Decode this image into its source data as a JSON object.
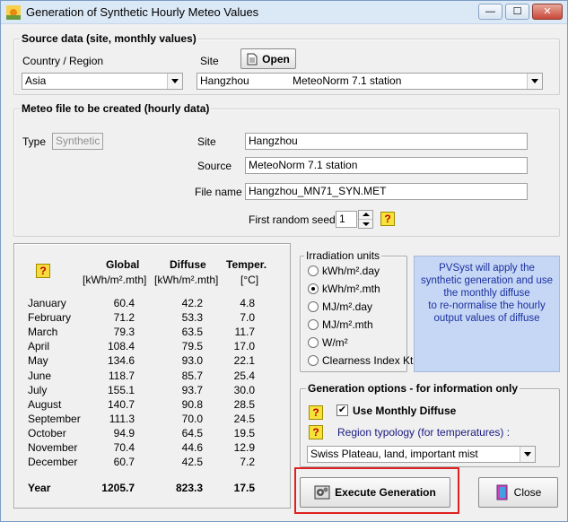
{
  "window": {
    "title": "Generation of Synthetic Hourly Meteo Values",
    "minimize": "—",
    "maximize": "☐",
    "close": "✕"
  },
  "source": {
    "legend": "Source data  (site, monthly values)",
    "country_label": "Country / Region",
    "country_value": "Asia",
    "site_label": "Site",
    "open_label": "Open",
    "site_name": "Hangzhou",
    "site_source": "MeteoNorm 7.1 station"
  },
  "meteo": {
    "legend": "Meteo file to be created (hourly data)",
    "type_label": "Type",
    "type_value": "Synthetic",
    "site_label": "Site",
    "site_value": "Hangzhou",
    "source_label": "Source",
    "source_value": "MeteoNorm 7.1 station",
    "filename_label": "File name",
    "filename_value": "Hangzhou_MN71_SYN.MET",
    "seed_label": "First random seed",
    "seed_value": "1"
  },
  "table": {
    "headers": [
      {
        "name": "Global",
        "unit": "[kWh/m².mth]"
      },
      {
        "name": "Diffuse",
        "unit": "[kWh/m².mth]"
      },
      {
        "name": "Temper.",
        "unit": "[°C]"
      }
    ],
    "rows": [
      {
        "month": "January",
        "global": "60.4",
        "diffuse": "42.2",
        "temp": "4.8"
      },
      {
        "month": "February",
        "global": "71.2",
        "diffuse": "53.3",
        "temp": "7.0"
      },
      {
        "month": "March",
        "global": "79.3",
        "diffuse": "63.5",
        "temp": "11.7"
      },
      {
        "month": "April",
        "global": "108.4",
        "diffuse": "79.5",
        "temp": "17.0"
      },
      {
        "month": "May",
        "global": "134.6",
        "diffuse": "93.0",
        "temp": "22.1"
      },
      {
        "month": "June",
        "global": "118.7",
        "diffuse": "85.7",
        "temp": "25.4"
      },
      {
        "month": "July",
        "global": "155.1",
        "diffuse": "93.7",
        "temp": "30.0"
      },
      {
        "month": "August",
        "global": "140.7",
        "diffuse": "90.8",
        "temp": "28.5"
      },
      {
        "month": "September",
        "global": "111.3",
        "diffuse": "70.0",
        "temp": "24.5"
      },
      {
        "month": "October",
        "global": "94.9",
        "diffuse": "64.5",
        "temp": "19.5"
      },
      {
        "month": "November",
        "global": "70.4",
        "diffuse": "44.6",
        "temp": "12.9"
      },
      {
        "month": "December",
        "global": "60.7",
        "diffuse": "42.5",
        "temp": "7.2"
      }
    ],
    "total": {
      "month": "Year",
      "global": "1205.7",
      "diffuse": "823.3",
      "temp": "17.5"
    }
  },
  "irradiation": {
    "legend": "Irradiation units",
    "options": [
      "kWh/m².day",
      "kWh/m².mth",
      "MJ/m².day",
      "MJ/m².mth",
      "W/m²",
      "Clearness Index Kt"
    ],
    "selected": "kWh/m².mth"
  },
  "info": {
    "text1": "PVSyst will apply the synthetic generation and use the monthly diffuse",
    "text2": "to re-normalise the hourly output values of diffuse"
  },
  "generation": {
    "legend": "Generation options - for information only",
    "use_monthly_diffuse": "Use Monthly Diffuse",
    "use_monthly_diffuse_checked": true,
    "typology_label": "Region typology  (for temperatures) :",
    "typology_value": "Swiss Plateau, land, important mist"
  },
  "actions": {
    "execute": "Execute Generation",
    "close": "Close"
  }
}
